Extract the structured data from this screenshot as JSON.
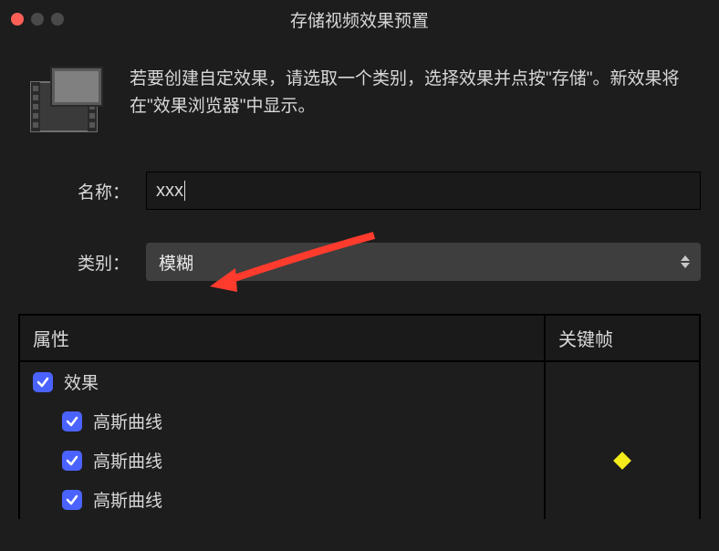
{
  "window": {
    "title": "存储视频效果预置"
  },
  "header": {
    "text": "若要创建自定效果，请选取一个类别，选择效果并点按\"存储\"。新效果将在\"效果浏览器\"中显示。"
  },
  "form": {
    "name_label": "名称：",
    "name_value": "xxx",
    "category_label": "类别：",
    "category_value": "模糊"
  },
  "table": {
    "headers": {
      "attribute": "属性",
      "keyframe": "关键帧"
    },
    "rows": [
      {
        "checked": true,
        "label": "效果",
        "indent": 0,
        "keyframe": false
      },
      {
        "checked": true,
        "label": "高斯曲线",
        "indent": 1,
        "keyframe": false
      },
      {
        "checked": true,
        "label": "高斯曲线",
        "indent": 1,
        "keyframe": true
      },
      {
        "checked": true,
        "label": "高斯曲线",
        "indent": 1,
        "keyframe": false
      }
    ]
  }
}
